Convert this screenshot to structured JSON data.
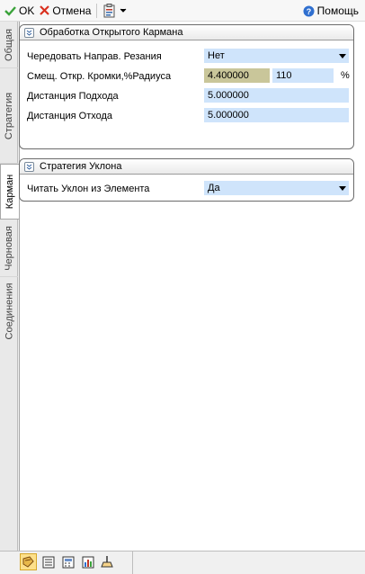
{
  "toolbar": {
    "ok_label": "OK",
    "cancel_label": "Отмена",
    "help_label": "Помощь"
  },
  "tabs": [
    {
      "label": "Общая"
    },
    {
      "label": "Стратегия"
    },
    {
      "label": "Карман"
    },
    {
      "label": "Черновая"
    },
    {
      "label": "Соединения"
    }
  ],
  "active_tab": "Карман",
  "groups": {
    "open_pocket": {
      "title": "Обработка Открытого Кармана",
      "rows": [
        {
          "label": "Чередовать Направ. Резания",
          "value": "Нет"
        },
        {
          "label": "Смещ. Откр. Кромки,%Радиуса",
          "value": "4.400000",
          "value2": "110",
          "unit": "%"
        },
        {
          "label": "Дистанция Подхода",
          "value": "5.000000"
        },
        {
          "label": "Дистанция Отхода",
          "value": "5.000000"
        }
      ]
    },
    "slope_strategy": {
      "title": "Стратегия Уклона",
      "rows": [
        {
          "label": "Читать Уклон из Элемента",
          "value": "Да"
        }
      ]
    }
  },
  "colors": {
    "field_blue": "#cfe4fb",
    "field_tan": "#c9c69a",
    "ok_green": "#3aa33a",
    "cancel_red": "#d9301e"
  },
  "bottom_icons": [
    "feature-icon",
    "list-icon",
    "calculator-icon",
    "chart-icon",
    "machine-icon"
  ]
}
